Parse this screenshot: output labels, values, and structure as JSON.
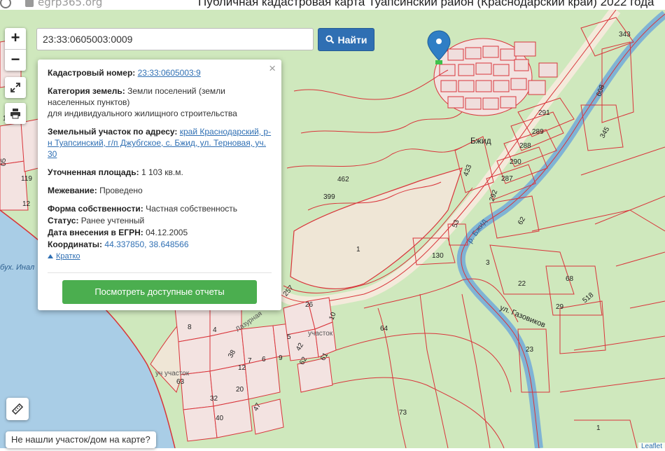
{
  "browser": {
    "site": "egrp365.org",
    "page_title": "Публичная кадастровая карта Туапсинский район (Краснодарский край) 2022 года"
  },
  "map": {
    "zoom_in": "+",
    "zoom_out": "−",
    "place_labels": [
      "Бжид",
      "р. Бжид",
      "ул. Газовиков",
      "бух. Инал",
      "уч участок",
      "участок",
      "Лазурная"
    ],
    "parcel_numbers": [
      "343",
      "608",
      "291",
      "345",
      "289",
      "288",
      "290",
      "433",
      "287",
      "292",
      "462",
      "399",
      "1",
      "53",
      "62",
      "130",
      "3",
      "22",
      "68",
      "29",
      "518",
      "23",
      "257",
      "26",
      "10",
      "8",
      "4",
      "9",
      "6",
      "7",
      "5",
      "42",
      "62",
      "61",
      "38",
      "12",
      "20",
      "32",
      "47",
      "40",
      "63",
      "64",
      "73",
      "1",
      "16",
      "119",
      "12",
      "05"
    ],
    "attribution": "Leaflet",
    "colors": {
      "map_bg": "#cfe8bd",
      "parcel_line": "#d9343a",
      "water": "#7fb3d5",
      "road": "#f4eadb"
    }
  },
  "search": {
    "value": "23:33:0605003:0009",
    "button_label": "Найти"
  },
  "popup": {
    "cadastral_label": "Кадастровый номер:",
    "cadastral_value": "23:33:0605003:9",
    "category_label": "Категория земель:",
    "category_value_1": "Земли поселений (земли",
    "category_value_2": "населенных пунктов)",
    "category_value_3": "для индивидуального жилищного строительства",
    "address_label": "Земельный участок по адресу:",
    "address_value_1": "край Краснодарский, р-",
    "address_value_2": "н Туапсинский, г/п Джубгское, с. Бжид, ул. Терновая, уч.",
    "address_value_3": "30",
    "area_label": "Уточненная площадь:",
    "area_value": "1 103 кв.м.",
    "survey_label": "Межевание:",
    "survey_value": "Проведено",
    "ownership_label": "Форма собственности:",
    "ownership_value": "Частная собственность",
    "status_label": "Статус:",
    "status_value": "Ранее учтенный",
    "date_label": "Дата внесения в ЕГРН:",
    "date_value": "04.12.2005",
    "coords_label": "Координаты:",
    "coords_value": "44.337850, 38.648566",
    "brief_label": "Кратко",
    "report_button": "Посмотреть доступные отчеты",
    "close": "×"
  },
  "not_found_label": "Не нашли участок/дом на карте?"
}
